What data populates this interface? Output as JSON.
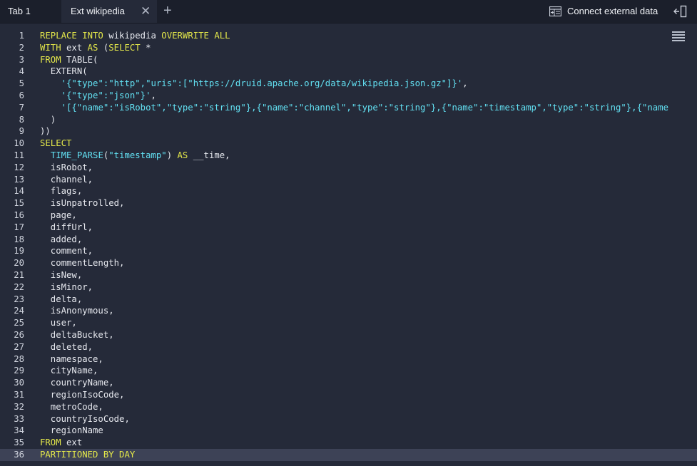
{
  "tabs": [
    {
      "label": "Tab 1",
      "active": false
    },
    {
      "label": "Ext wikipedia",
      "active": true
    }
  ],
  "toolbar": {
    "close_glyph": "✕",
    "add_glyph": "+",
    "connect_label": "Connect external data",
    "connect_icon": "table-import-icon",
    "collapse_icon": "panel-collapse-icon",
    "menu_icon": "hamburger-menu-icon"
  },
  "colors": {
    "background": "#252a39",
    "tabbar": "#1b1f2b",
    "keyword": "#e4e84a",
    "string": "#62e0f2",
    "active_line": "#3d4256"
  },
  "editor": {
    "active_line": 36,
    "lines": [
      [
        [
          "kw",
          "REPLACE INTO "
        ],
        [
          "tx",
          "wikipedia "
        ],
        [
          "kw",
          "OVERWRITE ALL"
        ]
      ],
      [
        [
          "kw",
          "WITH "
        ],
        [
          "tx",
          "ext "
        ],
        [
          "kw",
          "AS "
        ],
        [
          "tx",
          "("
        ],
        [
          "kw",
          "SELECT"
        ],
        [
          "tx",
          " *"
        ]
      ],
      [
        [
          "kw",
          "FROM "
        ],
        [
          "tx",
          "TABLE("
        ]
      ],
      [
        [
          "tx",
          "  EXTERN("
        ]
      ],
      [
        [
          "tx",
          "    "
        ],
        [
          "st",
          "'{\"type\":\"http\",\"uris\":[\"https://druid.apache.org/data/wikipedia.json.gz\"]}'"
        ],
        [
          "tx",
          ","
        ]
      ],
      [
        [
          "tx",
          "    "
        ],
        [
          "st",
          "'{\"type\":\"json\"}'"
        ],
        [
          "tx",
          ","
        ]
      ],
      [
        [
          "tx",
          "    "
        ],
        [
          "st",
          "'[{\"name\":\"isRobot\",\"type\":\"string\"},{\"name\":\"channel\",\"type\":\"string\"},{\"name\":\"timestamp\",\"type\":\"string\"},{\"name"
        ]
      ],
      [
        [
          "tx",
          "  )"
        ]
      ],
      [
        [
          "tx",
          "))"
        ]
      ],
      [
        [
          "kw",
          "SELECT"
        ]
      ],
      [
        [
          "tx",
          "  "
        ],
        [
          "fn",
          "TIME_PARSE"
        ],
        [
          "tx",
          "("
        ],
        [
          "st",
          "\"timestamp\""
        ],
        [
          "tx",
          ") "
        ],
        [
          "kw",
          "AS "
        ],
        [
          "tx",
          "__time,"
        ]
      ],
      [
        [
          "tx",
          "  isRobot,"
        ]
      ],
      [
        [
          "tx",
          "  channel,"
        ]
      ],
      [
        [
          "tx",
          "  flags,"
        ]
      ],
      [
        [
          "tx",
          "  isUnpatrolled,"
        ]
      ],
      [
        [
          "tx",
          "  page,"
        ]
      ],
      [
        [
          "tx",
          "  diffUrl,"
        ]
      ],
      [
        [
          "tx",
          "  added,"
        ]
      ],
      [
        [
          "tx",
          "  comment,"
        ]
      ],
      [
        [
          "tx",
          "  commentLength,"
        ]
      ],
      [
        [
          "tx",
          "  isNew,"
        ]
      ],
      [
        [
          "tx",
          "  isMinor,"
        ]
      ],
      [
        [
          "tx",
          "  delta,"
        ]
      ],
      [
        [
          "tx",
          "  isAnonymous,"
        ]
      ],
      [
        [
          "tx",
          "  user,"
        ]
      ],
      [
        [
          "tx",
          "  deltaBucket,"
        ]
      ],
      [
        [
          "tx",
          "  deleted,"
        ]
      ],
      [
        [
          "tx",
          "  namespace,"
        ]
      ],
      [
        [
          "tx",
          "  cityName,"
        ]
      ],
      [
        [
          "tx",
          "  countryName,"
        ]
      ],
      [
        [
          "tx",
          "  regionIsoCode,"
        ]
      ],
      [
        [
          "tx",
          "  metroCode,"
        ]
      ],
      [
        [
          "tx",
          "  countryIsoCode,"
        ]
      ],
      [
        [
          "tx",
          "  regionName"
        ]
      ],
      [
        [
          "kw",
          "FROM "
        ],
        [
          "tx",
          "ext"
        ]
      ],
      [
        [
          "kw",
          "PARTITIONED BY DAY"
        ]
      ]
    ]
  }
}
